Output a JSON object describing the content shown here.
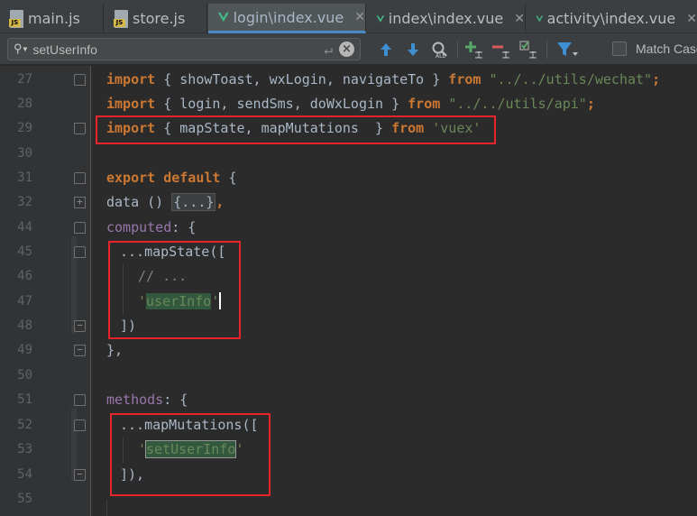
{
  "tabs": [
    {
      "label": "main.js",
      "icon": "js-file-icon",
      "active": false
    },
    {
      "label": "store.js",
      "icon": "js-file-icon",
      "active": false
    },
    {
      "label": "login\\index.vue",
      "icon": "vue-icon",
      "active": true
    },
    {
      "label": "index\\index.vue",
      "icon": "vue-icon",
      "active": false
    },
    {
      "label": "activity\\index.vue",
      "icon": "vue-icon",
      "active": false
    }
  ],
  "search": {
    "value": "setUserInfo",
    "match_case_label": "Match Case"
  },
  "gutter": {
    "line_numbers": [
      "27",
      "28",
      "29",
      "30",
      "31",
      "32",
      "44",
      "45",
      "46",
      "47",
      "48",
      "49",
      "50",
      "51",
      "52",
      "53",
      "54",
      "55"
    ]
  },
  "code": {
    "l27": {
      "import": "import",
      "a": "{ showToast, wxLogin, navigateTo }",
      "from": "from",
      "path": "\"../../utils/wechat\"",
      "semi": ";"
    },
    "l28": {
      "import": "import",
      "a": "{ login, sendSms, doWxLogin }",
      "from": "from",
      "path": "\"../../utils/api\"",
      "semi": ";"
    },
    "l29": {
      "import": "import",
      "a": "{ mapState, mapMutations  }",
      "from": "from",
      "path": "'vuex'"
    },
    "l31": {
      "export": "export",
      "default": "default",
      "brace": "{"
    },
    "l32": {
      "name": "data",
      "parens": " () ",
      "placeholder": "{...}",
      "comma": ","
    },
    "l44": {
      "name": "computed",
      "rest": ": {"
    },
    "l45": {
      "text": "...mapState(["
    },
    "l46": {
      "comment": "// ..."
    },
    "l47": {
      "q1": "'",
      "value": "userInfo",
      "q2": "'"
    },
    "l48": {
      "text": "])"
    },
    "l49": {
      "text": "},"
    },
    "l51": {
      "name": "methods",
      "rest": ": {"
    },
    "l52": {
      "text": "...mapMutations(["
    },
    "l53": {
      "q1": "'",
      "value": "setUserInfo",
      "q2": "'"
    },
    "l54": {
      "text": "]),"
    }
  }
}
